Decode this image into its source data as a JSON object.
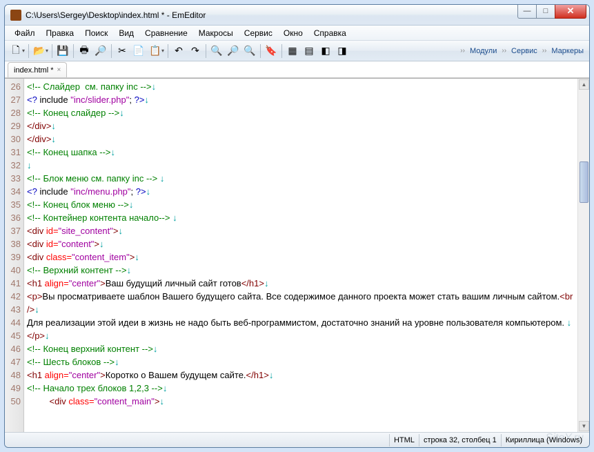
{
  "title": "C:\\Users\\Sergey\\Desktop\\index.html * - EmEditor",
  "menu": [
    "Файл",
    "Правка",
    "Поиск",
    "Вид",
    "Сравнение",
    "Макросы",
    "Сервис",
    "Окно",
    "Справка"
  ],
  "rightTools": [
    "Модули",
    "Сервис",
    "Маркеры"
  ],
  "tab": {
    "label": "index.html *"
  },
  "status": {
    "lang": "HTML",
    "pos": "строка 32, столбец 1",
    "enc": "Кириллица (Windows)"
  },
  "watermark": "SiteY.ru",
  "icons": {
    "new": "🗋",
    "open": "📂",
    "save": "💾",
    "print": "🖶",
    "preview": "🔎",
    "cut": "✂",
    "copy": "📄",
    "paste": "📋",
    "undo": "↶",
    "redo": "↷",
    "find": "🔍",
    "zoomIn": "🔎",
    "zoomOut": "🔍",
    "bookmark": "🔖",
    "grid": "▦",
    "wrap": "▤",
    "hl1": "◧",
    "hl2": "◨"
  },
  "lines": [
    {
      "n": 26,
      "seg": [
        [
          "c-cm",
          "<!-- Слайдер  см. папку inc -->"
        ],
        [
          "c-nl",
          "↓"
        ]
      ]
    },
    {
      "n": 27,
      "seg": [
        [
          "c-bl",
          "<?"
        ],
        [
          "c-tx",
          " include "
        ],
        [
          "c-st",
          "\"inc/slider.php\""
        ],
        [
          "c-tx",
          "; "
        ],
        [
          "c-bl",
          "?>"
        ],
        [
          "c-nl",
          "↓"
        ]
      ]
    },
    {
      "n": 28,
      "seg": [
        [
          "c-cm",
          "<!-- Конец слайдер -->"
        ],
        [
          "c-nl",
          "↓"
        ]
      ]
    },
    {
      "n": 29,
      "seg": [
        [
          "c-tg",
          "</div>"
        ],
        [
          "c-nl",
          "↓"
        ]
      ]
    },
    {
      "n": 30,
      "seg": [
        [
          "c-tg",
          "</div>"
        ],
        [
          "c-nl",
          "↓"
        ]
      ]
    },
    {
      "n": 31,
      "seg": [
        [
          "c-cm",
          "<!-- Конец шапка -->"
        ],
        [
          "c-nl",
          "↓"
        ]
      ]
    },
    {
      "n": 32,
      "seg": [
        [
          "c-nl",
          "↓"
        ]
      ]
    },
    {
      "n": 33,
      "seg": [
        [
          "c-cm",
          "<!-- Блок меню см. папку inc --> "
        ],
        [
          "c-nl",
          "↓"
        ]
      ]
    },
    {
      "n": 34,
      "seg": [
        [
          "c-bl",
          "<?"
        ],
        [
          "c-tx",
          " include "
        ],
        [
          "c-st",
          "\"inc/menu.php\""
        ],
        [
          "c-tx",
          "; "
        ],
        [
          "c-bl",
          "?>"
        ],
        [
          "c-nl",
          "↓"
        ]
      ]
    },
    {
      "n": 35,
      "seg": [
        [
          "c-cm",
          "<!-- Конец блок меню -->"
        ],
        [
          "c-nl",
          "↓"
        ]
      ]
    },
    {
      "n": 36,
      "seg": [
        [
          "c-tx",
          ""
        ]
      ]
    },
    {
      "n": 37,
      "seg": [
        [
          "c-cm",
          "<!-- Контейнер контента начало--> "
        ],
        [
          "c-nl",
          "↓"
        ]
      ]
    },
    {
      "n": 38,
      "seg": [
        [
          "c-tg",
          "<div "
        ],
        [
          "c-at",
          "id="
        ],
        [
          "c-st",
          "\"site_content\""
        ],
        [
          "c-tg",
          ">"
        ],
        [
          "c-nl",
          "↓"
        ]
      ]
    },
    {
      "n": 39,
      "seg": [
        [
          "c-tg",
          "<div "
        ],
        [
          "c-at",
          "id="
        ],
        [
          "c-st",
          "\"content\""
        ],
        [
          "c-tg",
          ">"
        ],
        [
          "c-nl",
          "↓"
        ]
      ]
    },
    {
      "n": 40,
      "seg": [
        [
          "c-tg",
          "<div "
        ],
        [
          "c-at",
          "class="
        ],
        [
          "c-st",
          "\"content_item\""
        ],
        [
          "c-tg",
          ">"
        ],
        [
          "c-nl",
          "↓"
        ]
      ]
    },
    {
      "n": 41,
      "seg": [
        [
          "c-cm",
          "<!-- Верхний контент -->"
        ],
        [
          "c-nl",
          "↓"
        ]
      ]
    },
    {
      "n": 42,
      "seg": [
        [
          "c-tg",
          "<h1 "
        ],
        [
          "c-at",
          "align="
        ],
        [
          "c-st",
          "\"center\""
        ],
        [
          "c-tg",
          ">"
        ],
        [
          "c-tx",
          "Ваш будущий личный сайт готов"
        ],
        [
          "c-tg",
          "</h1>"
        ],
        [
          "c-nl",
          "↓"
        ]
      ]
    },
    {
      "n": 43,
      "seg": [
        [
          "c-tg",
          "<p>"
        ],
        [
          "c-tx",
          "Вы просматриваете шаблон Вашего будущего сайта. Все cодержимое данного проекта может стать вашим личным сайтом."
        ],
        [
          "c-tg",
          "<br />"
        ],
        [
          "c-nl",
          "↓"
        ]
      ]
    },
    {
      "n": 44,
      "seg": [
        [
          "c-tx",
          "Для реализации этой идеи в жизнь не надо быть веб-программистом, достаточно знаний на уровне пользователя компьютером. "
        ],
        [
          "c-nl",
          "↓"
        ]
      ]
    },
    {
      "n": 45,
      "seg": [
        [
          "c-tg",
          "</p>"
        ],
        [
          "c-nl",
          "↓"
        ]
      ]
    },
    {
      "n": 46,
      "seg": [
        [
          "c-cm",
          "<!-- Конец верхний контент -->"
        ],
        [
          "c-nl",
          "↓"
        ]
      ]
    },
    {
      "n": 47,
      "seg": [
        [
          "c-cm",
          "<!-- Шесть блоков -->"
        ],
        [
          "c-nl",
          "↓"
        ]
      ]
    },
    {
      "n": 48,
      "seg": [
        [
          "c-tg",
          "<h1 "
        ],
        [
          "c-at",
          "align="
        ],
        [
          "c-st",
          "\"center\""
        ],
        [
          "c-tg",
          ">"
        ],
        [
          "c-tx",
          "Коротко о Вашем будущем сайте."
        ],
        [
          "c-tg",
          "</h1>"
        ],
        [
          "c-nl",
          "↓"
        ]
      ]
    },
    {
      "n": 49,
      "seg": [
        [
          "c-cm",
          "<!-- Начало трех блоков 1,2,3 -->"
        ],
        [
          "c-nl",
          "↓"
        ]
      ]
    },
    {
      "n": 50,
      "seg": [
        [
          "c-tx",
          "         "
        ],
        [
          "c-tg",
          "<div "
        ],
        [
          "c-at",
          "class="
        ],
        [
          "c-st",
          "\"content_main\""
        ],
        [
          "c-tg",
          ">"
        ],
        [
          "c-nl",
          "↓"
        ]
      ]
    }
  ]
}
